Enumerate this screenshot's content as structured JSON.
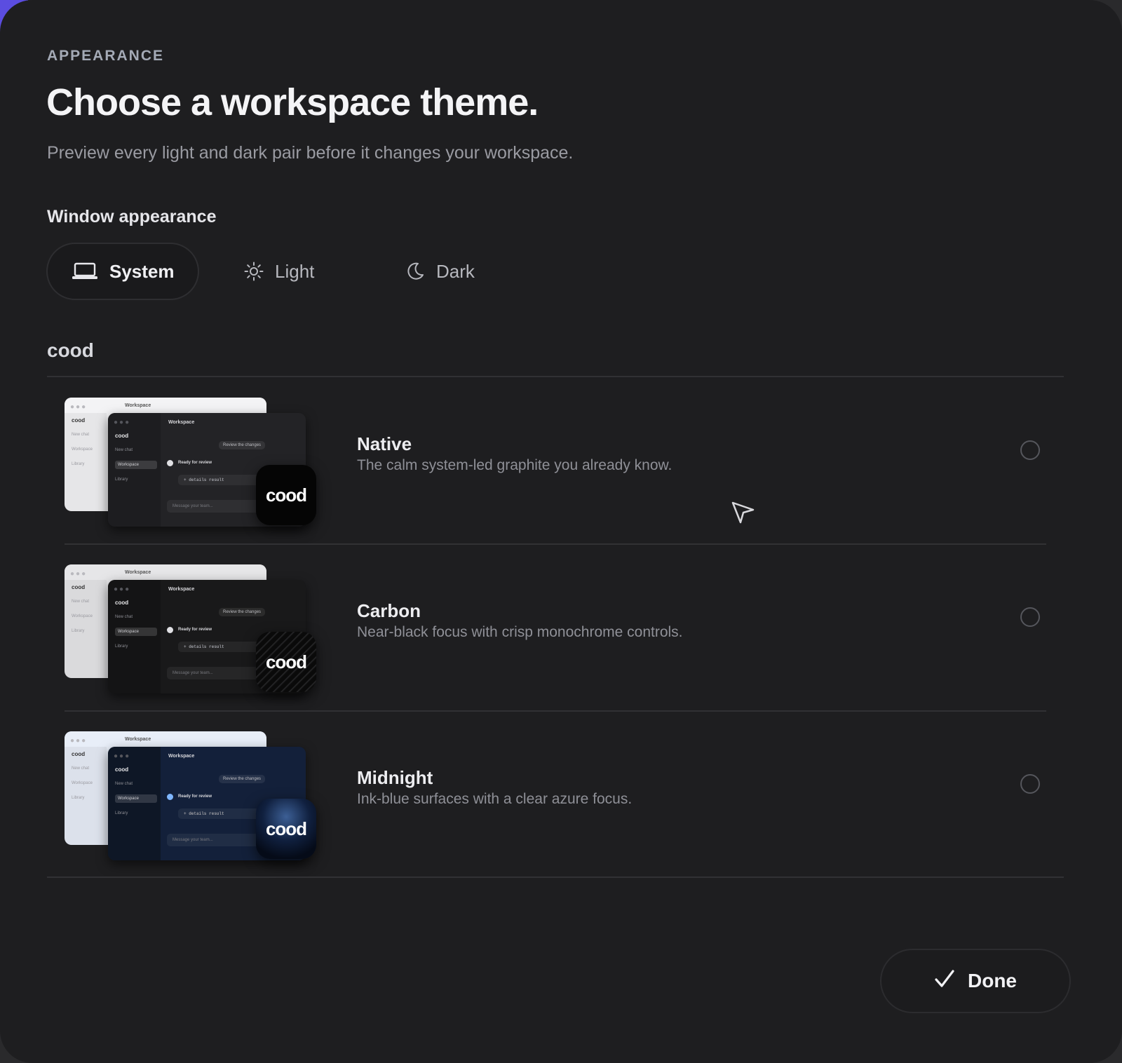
{
  "header": {
    "eyebrow": "APPEARANCE",
    "title": "Choose a workspace theme.",
    "subtitle": "Preview every light and dark pair before it changes your workspace."
  },
  "window_appearance": {
    "label": "Window appearance",
    "options": [
      {
        "label": "System",
        "icon": "laptop-icon",
        "selected": true
      },
      {
        "label": "Light",
        "icon": "sun-icon",
        "selected": false
      },
      {
        "label": "Dark",
        "icon": "moon-icon",
        "selected": false
      }
    ]
  },
  "theme_group": {
    "label": "cood",
    "themes": [
      {
        "name": "Native",
        "description": "The calm system-led graphite you already know.",
        "selected": false,
        "colors": {
          "front_side": "#1d1d20",
          "front_main": "#232326",
          "back": "#f3f3f5",
          "icon_bg": "#050505"
        }
      },
      {
        "name": "Carbon",
        "description": "Near-black focus with crisp monochrome controls.",
        "selected": false,
        "colors": {
          "front_side": "#141415",
          "front_main": "#19191a",
          "back": "#e6e6e8",
          "icon_bg": "#0b0b0b"
        }
      },
      {
        "name": "Midnight",
        "description": "Ink-blue surfaces with a clear azure focus.",
        "selected": false,
        "colors": {
          "front_side": "#0e1726",
          "front_main": "#13203a",
          "back": "#e8eef8",
          "icon_bg": "#0a1428"
        }
      }
    ],
    "preview_text": {
      "brand": "cood",
      "window_title": "Workspace",
      "sidebar_items": [
        "New chat",
        "Workspace",
        "Library"
      ],
      "review_button": "Review the changes",
      "status": "Ready for review",
      "code_line": "+ details result",
      "composer_placeholder": "Message your team...",
      "app_icon_text": "cood"
    }
  },
  "footer": {
    "done_label": "Done"
  },
  "colors": {
    "accent": "#5b4de0",
    "dialog_bg": "#1e1e20",
    "text_primary": "#f4f4f6",
    "text_secondary": "#9a9ba2"
  }
}
